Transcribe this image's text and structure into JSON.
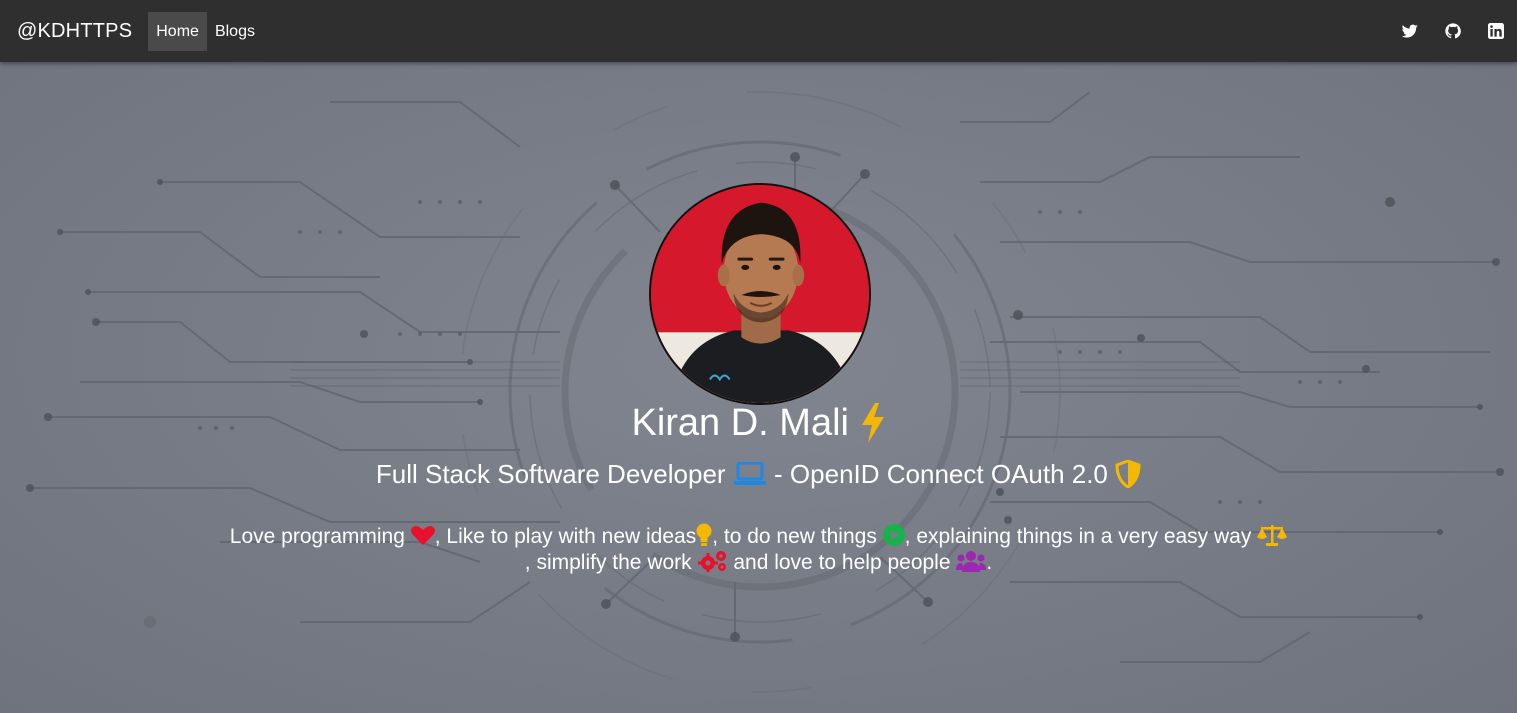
{
  "navbar": {
    "brand": "@KDHTTPS",
    "links": [
      {
        "label": "Home",
        "active": true
      },
      {
        "label": "Blogs",
        "active": false
      }
    ],
    "social_icons": [
      "twitter-icon",
      "github-icon",
      "linkedin-icon"
    ]
  },
  "hero": {
    "name": "Kiran D. Mali",
    "name_icon": "lightning-bolt-icon",
    "subtitle_part1": "Full Stack Software Developer",
    "subtitle_icon1": "laptop-icon",
    "subtitle_part2": "- OpenID Connect OAuth 2.0",
    "subtitle_icon2": "shield-icon",
    "bio": {
      "t1": "Love programming",
      "t2": ", Like to play with new ideas",
      "t3": ", to do new things",
      "t4": ", explaining things in a very easy way",
      "t5": ", simplify the work",
      "t6": "and love to help people",
      "t7": "."
    }
  },
  "colors": {
    "navbar_bg": "#2f2f2f",
    "hero_bg": "#787c86",
    "bolt": "#f5b800",
    "laptop": "#1e88e5",
    "shield": "#f5b800",
    "heart": "#e8102a",
    "bulb": "#f5b800",
    "play": "#17b24b",
    "scale": "#f5b800",
    "gears": "#e8102a",
    "people": "#9c27b0"
  }
}
